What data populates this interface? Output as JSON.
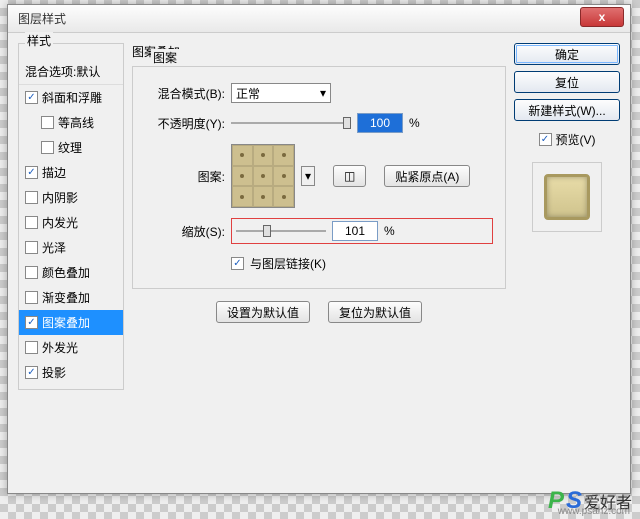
{
  "dialog": {
    "title": "图层样式",
    "close": "x"
  },
  "styles_panel": {
    "header": "样式",
    "blending_options": "混合选项:默认",
    "items": [
      {
        "key": "bevel",
        "label": "斜面和浮雕",
        "checked": true,
        "sub": false
      },
      {
        "key": "contour",
        "label": "等高线",
        "checked": false,
        "sub": true
      },
      {
        "key": "texture",
        "label": "纹理",
        "checked": false,
        "sub": true
      },
      {
        "key": "stroke",
        "label": "描边",
        "checked": true,
        "sub": false
      },
      {
        "key": "inner-shadow",
        "label": "内阴影",
        "checked": false,
        "sub": false
      },
      {
        "key": "inner-glow",
        "label": "内发光",
        "checked": false,
        "sub": false
      },
      {
        "key": "satin",
        "label": "光泽",
        "checked": false,
        "sub": false
      },
      {
        "key": "color-overlay",
        "label": "颜色叠加",
        "checked": false,
        "sub": false
      },
      {
        "key": "gradient-overlay",
        "label": "渐变叠加",
        "checked": false,
        "sub": false
      },
      {
        "key": "pattern-overlay",
        "label": "图案叠加",
        "checked": true,
        "sub": false,
        "selected": true
      },
      {
        "key": "outer-glow",
        "label": "外发光",
        "checked": false,
        "sub": false
      },
      {
        "key": "drop-shadow",
        "label": "投影",
        "checked": true,
        "sub": false
      }
    ]
  },
  "pattern_overlay": {
    "title": "图案叠加",
    "group": "图案",
    "blend_mode_label": "混合模式(B):",
    "blend_mode_value": "正常",
    "opacity_label": "不透明度(Y):",
    "opacity_value": "100",
    "percent": "%",
    "pattern_label": "图案:",
    "snap_button": "贴紧原点(A)",
    "scale_label": "缩放(S):",
    "scale_value": "101",
    "link_label": "与图层链接(K)",
    "link_checked": true,
    "set_default": "设置为默认值",
    "reset_default": "复位为默认值"
  },
  "right": {
    "ok": "确定",
    "cancel": "复位",
    "new_style": "新建样式(W)...",
    "preview_label": "预览(V)",
    "preview_checked": true
  },
  "watermark": {
    "p": "P",
    "s": "S",
    "cn": "爱好者",
    "url": "www.psahz.com"
  }
}
